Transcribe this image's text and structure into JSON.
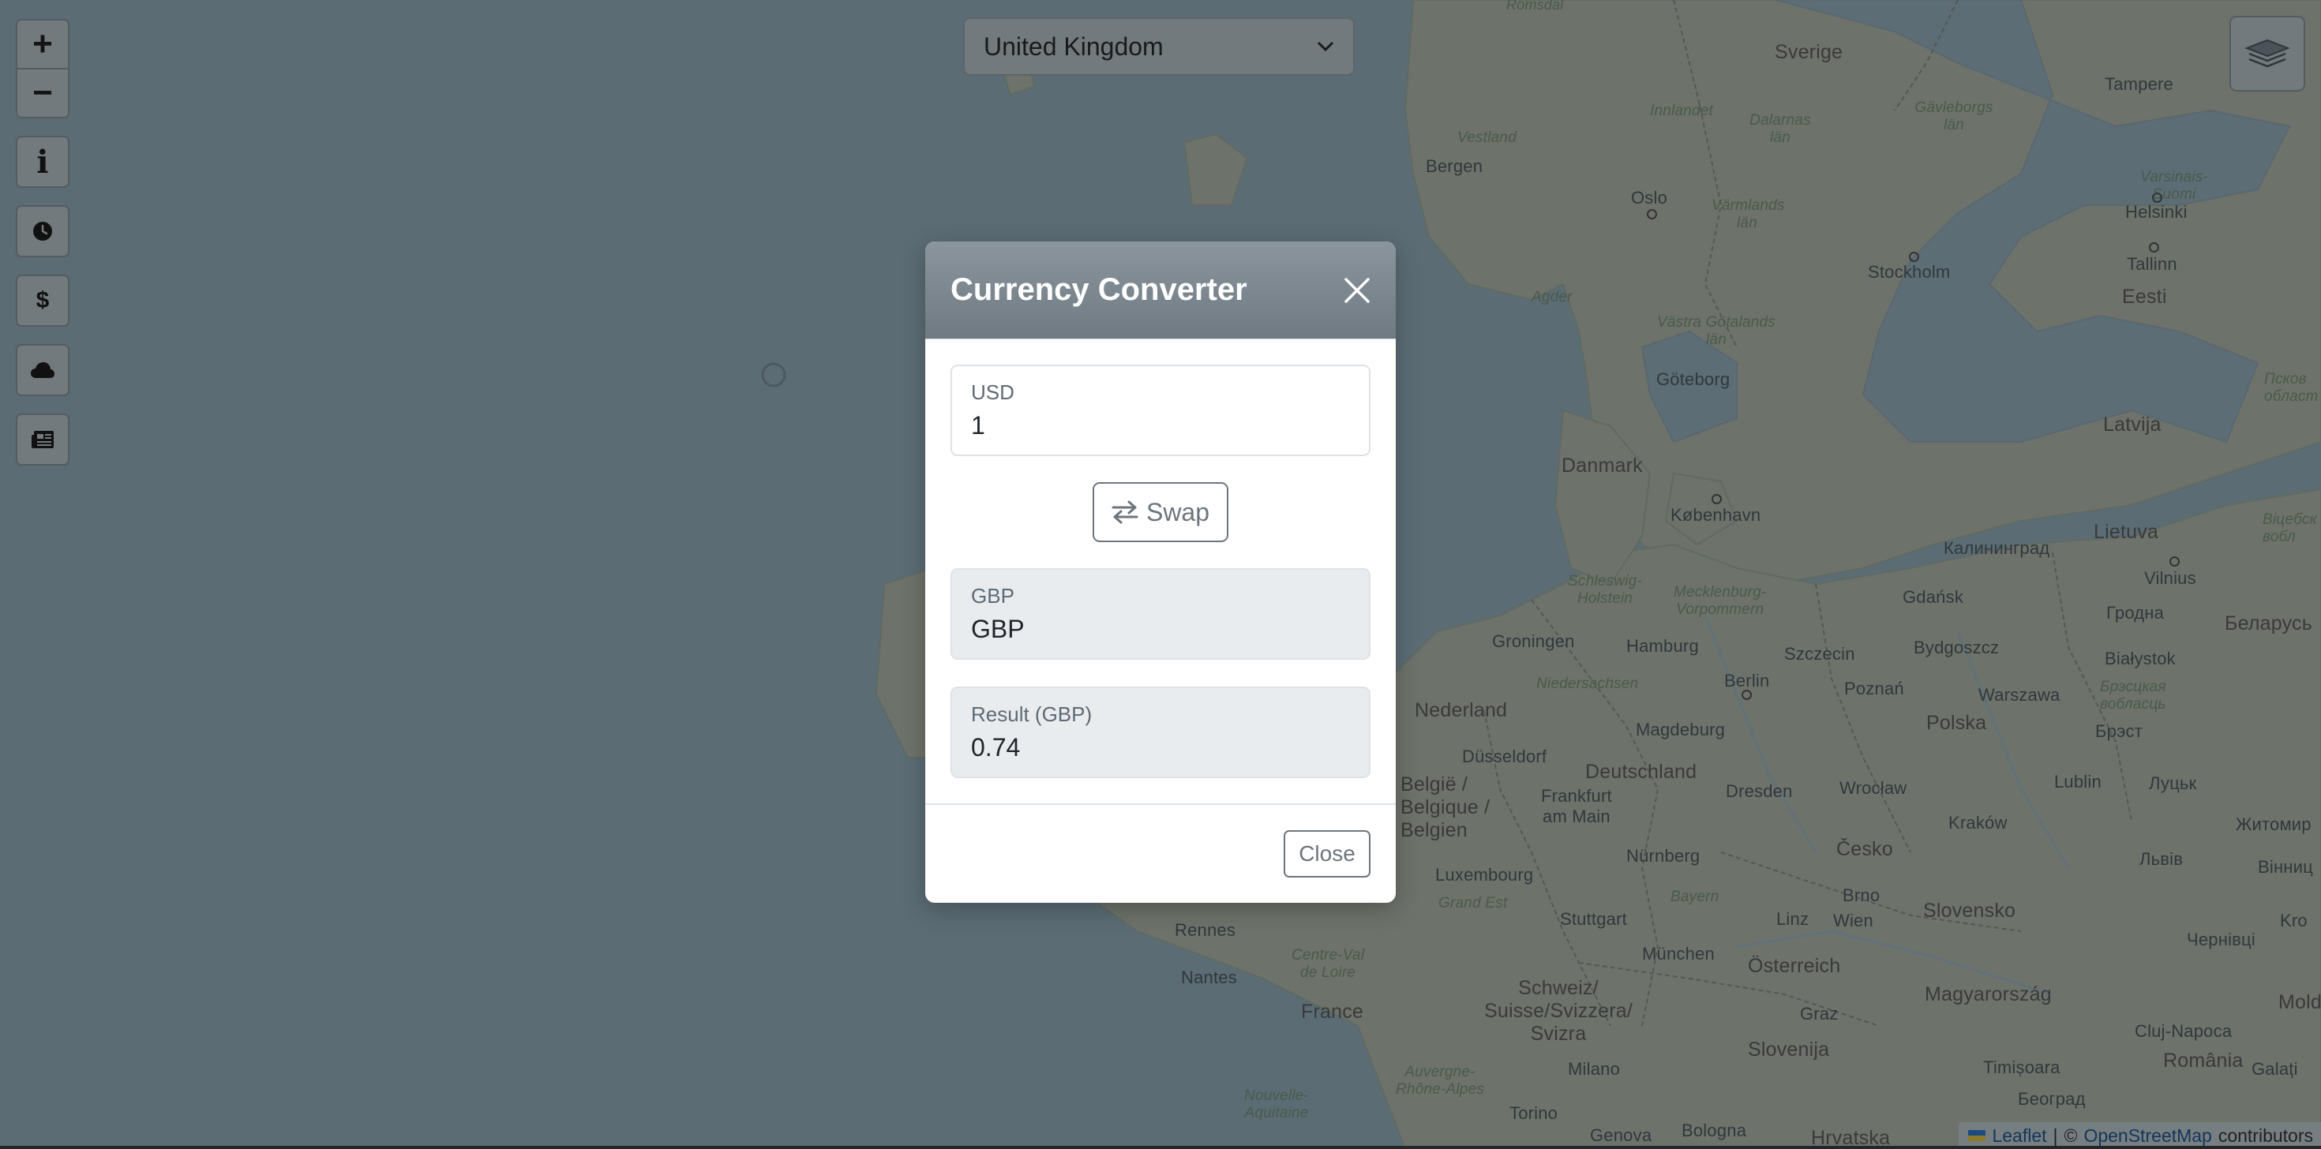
{
  "map": {
    "labels": {
      "sverige": "Sverige",
      "tampere": "Tampere",
      "inlandet": "Innlandet",
      "dalarnas_lan": "Dalarnas län",
      "gavleborgs_lan": "Gävleborgs län",
      "vestland": "Vestland",
      "bergen": "Bergen",
      "oslo": "Oslo",
      "varmlands_lan": "Värmlands län",
      "varsinais_suomi": "Varsinais-Suomi",
      "helsinki": "Helsinki",
      "tallinn": "Tallinn",
      "stockholm": "Stockholm",
      "eesti": "Eesti",
      "agder": "Agder",
      "vastra_gotalands_lan": "Västra Götalands län",
      "goteborg": "Göteborg",
      "pskov": "Псков\nобласт",
      "latvija": "Latvija",
      "danmark": "Danmark",
      "kobenhavn": "København",
      "lietuva": "Lietuva",
      "kaliningrad": "Калининград",
      "vitebsk": "Віцебск\nвобл",
      "vilnius": "Vilnius",
      "schleswig_holstein": "Schleswig-\nHolstein",
      "mecklenburg": "Mecklenburg-\nVorpommern",
      "gdansk": "Gdańsk",
      "grodno": "Гродна",
      "belarus": "Беларусь",
      "groningen": "Groningen",
      "hamburg": "Hamburg",
      "szczecin": "Szczecin",
      "bydgoszcz": "Bydgoszcz",
      "bialystok": "Białystok",
      "niedersachsen": "Niedersachsen",
      "berlin": "Berlin",
      "poznan": "Poznań",
      "warszawa": "Warszawa",
      "brest_obl": "Брэсцкая\nвобласць",
      "nederland": "Nederland",
      "magdeburg": "Magdeburg",
      "polska": "Polska",
      "brest": "Брэст",
      "dusseldorf": "Düsseldorf",
      "deutschland": "Deutschland",
      "belgie": "België /\nBelgique /\nBelgien",
      "frankfurt": "Frankfurt\nam Main",
      "dresden": "Dresden",
      "wroclaw": "Wrocław",
      "lublin": "Lublin",
      "lutsk": "Луцьк",
      "krakow": "Kraków",
      "zhytomyr": "Житомир",
      "luxembourg": "Luxembourg",
      "nurnberg": "Nürnberg",
      "cesko": "Česko",
      "lviv": "Львів",
      "vinnytsia": "Вінниц",
      "grand_est": "Grand Est",
      "bayern": "Bayern",
      "brno": "Brno",
      "rennes": "Rennes",
      "stuttgart": "Stuttgart",
      "linz": "Linz",
      "wien": "Wien",
      "slovensko": "Slovensko",
      "kro": "Kro",
      "centre_val_de_loire": "Centre-Val\nde Loire",
      "munchen": "München",
      "osterreich": "Österreich",
      "chernivtsi": "Чернівці",
      "nantes": "Nantes",
      "schweiz": "Schweiz/\nSuisse/Svizzera/\nSvizra",
      "magyarorszag": "Magyarország",
      "moldo": "Moldo",
      "france": "France",
      "graz": "Graz",
      "cluj": "Cluj-Napoca",
      "milano": "Milano",
      "slovenija": "Slovenija",
      "timisoara": "Timișoara",
      "romania": "România",
      "auvergne": "Auvergne-\nRhône-Alpes",
      "galati": "Galați",
      "nouvelle_aquitaine": "Nouvelle-\nAquitaine",
      "torino": "Torino",
      "beograd": "Београд",
      "genova": "Genova",
      "bologna": "Bologna",
      "hrvatska": "Hrvatska",
      "romsdal": "Romsdal"
    }
  },
  "controls": {
    "zoom_in": "+",
    "zoom_out": "−",
    "buttons": [
      {
        "name": "info",
        "icon": "info-icon"
      },
      {
        "name": "clock",
        "icon": "clock-icon"
      },
      {
        "name": "currency",
        "icon": "dollar-icon",
        "label": "$"
      },
      {
        "name": "weather",
        "icon": "cloud-icon"
      },
      {
        "name": "news",
        "icon": "newspaper-icon"
      }
    ],
    "info_glyph": "i",
    "dollar_glyph": "$",
    "layers_icon": "layers-icon"
  },
  "country_select": {
    "selected": "United Kingdom"
  },
  "attribution": {
    "leaflet": "Leaflet",
    "separator": "|",
    "copyright": "©",
    "osm": "OpenStreetMap",
    "contributors": "contributors"
  },
  "modal": {
    "title": "Currency Converter",
    "from_field": {
      "label": "USD",
      "value": "1"
    },
    "swap_label": "Swap",
    "to_field": {
      "label": "GBP",
      "value": "GBP"
    },
    "result_field": {
      "label": "Result (GBP)",
      "value": "0.74"
    },
    "close_label": "Close"
  },
  "colors": {
    "overlay_sea": "#5b6c74",
    "modal_header": "#7c8790",
    "button_outline": "#6c757d",
    "disabled_field": "#e9ecef"
  }
}
